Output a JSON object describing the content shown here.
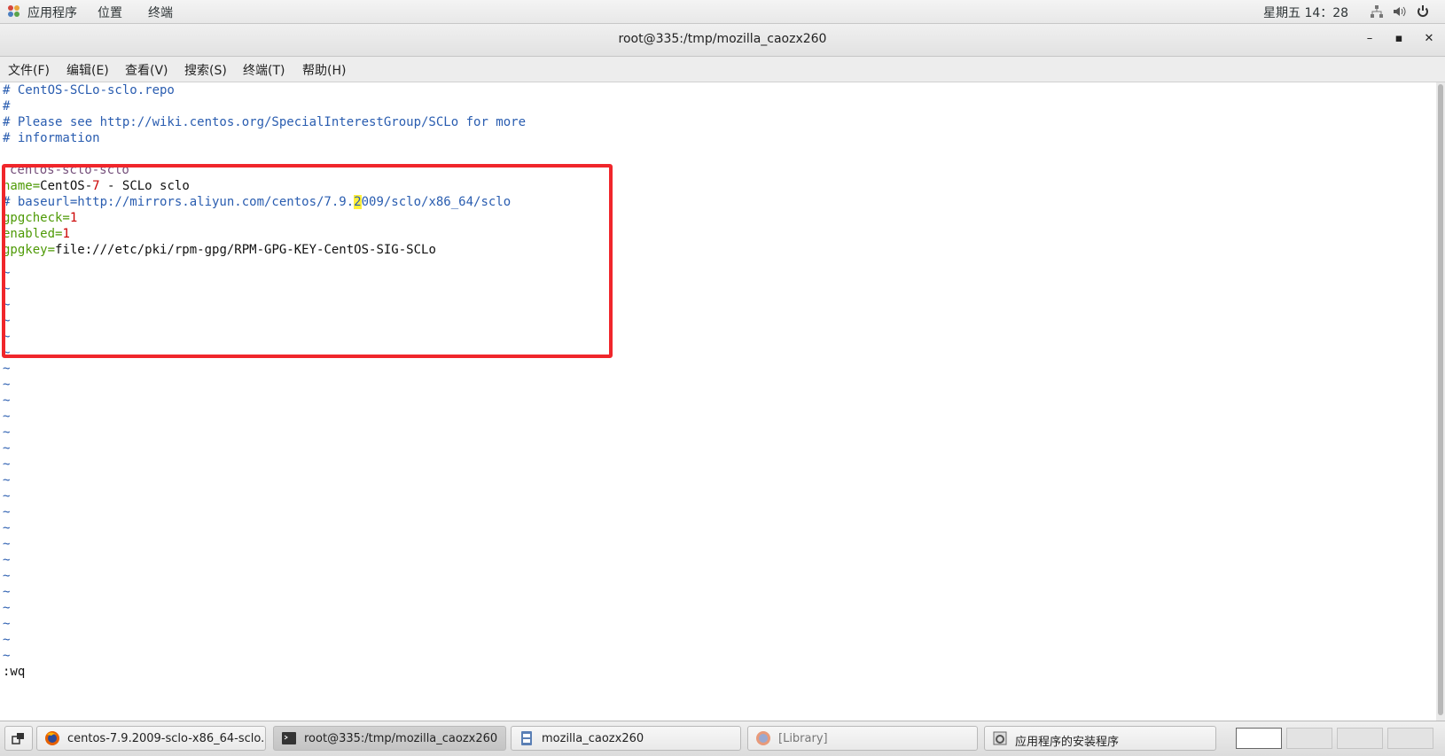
{
  "top_panel": {
    "applications": "应用程序",
    "places": "位置",
    "terminal": "终端",
    "clock": "星期五 14：28"
  },
  "window": {
    "title": "root@335:/tmp/mozilla_caozx260",
    "minimize": "–",
    "maximize": "▪",
    "close": "✕"
  },
  "menu": {
    "file": "文件(F)",
    "edit": "编辑(E)",
    "view": "查看(V)",
    "search": "搜索(S)",
    "terminal": "终端(T)",
    "help": "帮助(H)"
  },
  "editor": {
    "line1": "# CentOS-SCLo-sclo.repo",
    "line2": "#",
    "line3": "# Please see http://wiki.centos.org/SpecialInterestGroup/SCLo for more",
    "line4": "# information",
    "section": "centos-sclo-sclo",
    "name_key": "name=",
    "name_val_a": "CentOS-",
    "name_val_num": "7",
    "name_val_b": " - SCLo sclo",
    "baseurl_a": "# baseurl=http://mirrors.aliyun.com/centos/7.9.",
    "baseurl_hl": "2",
    "baseurl_b": "009/sclo/x86_64/sclo",
    "gpgcheck_key": "gpgcheck=",
    "gpgcheck_val": "1",
    "enabled_key": "enabled=",
    "enabled_val": "1",
    "gpgkey_key": "gpgkey=",
    "gpgkey_val": "file:///etc/pki/rpm-gpg/RPM-GPG-KEY-CentOS-SIG-SCLo",
    "tilde": "~",
    "command": ":wq"
  },
  "taskbar": {
    "task1": "centos-7.9.2009-sclo-x86_64-sclo...",
    "task2": "root@335:/tmp/mozilla_caozx260",
    "task3": "mozilla_caozx260",
    "task4": "[Library]",
    "task5": "应用程序的安装程序"
  },
  "colors": {
    "highlight_box": "#f0262b",
    "comment_blue": "#2a5db0",
    "key_green": "#4e9a06"
  }
}
